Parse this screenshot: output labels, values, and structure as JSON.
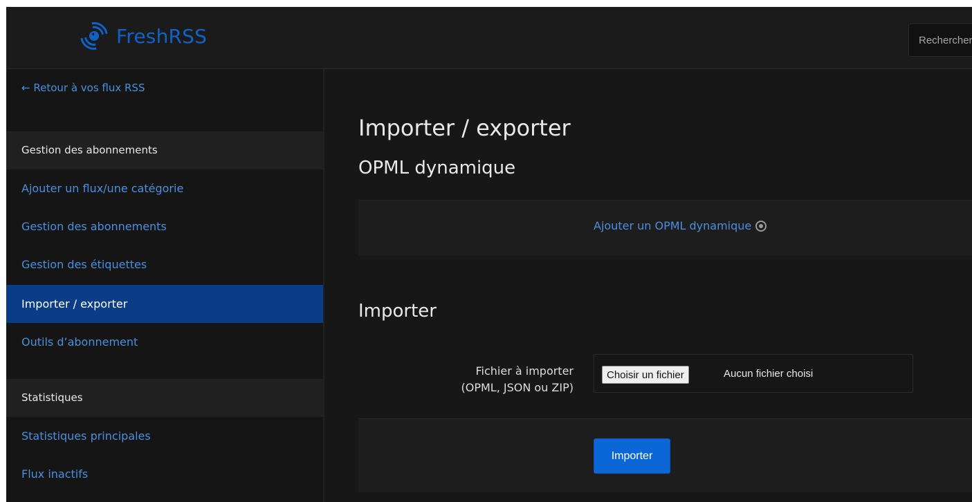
{
  "header": {
    "app_name": "FreshRSS",
    "logo_icon": "rss-signal-icon",
    "search_placeholder": "Rechercher"
  },
  "sidebar": {
    "back_link": "← Retour à vos flux RSS",
    "groups": [
      {
        "title": "Gestion des abonnements",
        "items": [
          {
            "label": "Ajouter un flux/une catégorie",
            "active": false
          },
          {
            "label": "Gestion des abonnements",
            "active": false
          },
          {
            "label": "Gestion des étiquettes",
            "active": false
          },
          {
            "label": "Importer / exporter",
            "active": true
          },
          {
            "label": "Outils d’abonnement",
            "active": false
          }
        ]
      },
      {
        "title": "Statistiques",
        "items": [
          {
            "label": "Statistiques principales",
            "active": false
          },
          {
            "label": "Flux inactifs",
            "active": false
          }
        ]
      }
    ]
  },
  "main": {
    "title": "Importer / exporter",
    "opml_section": {
      "title": "OPML dynamique",
      "add_link": "Ajouter un OPML dynamique",
      "help_icon": "help-circle-icon"
    },
    "import_section": {
      "title": "Importer",
      "file_label_line1": "Fichier à importer",
      "file_label_line2": "(OPML, JSON ou ZIP)",
      "choose_button": "Choisir un fichier",
      "no_file_text": "Aucun fichier choisi",
      "submit_label": "Importer"
    }
  },
  "colors": {
    "accent": "#0f63c8",
    "link": "#4a8fdf",
    "active_item_bg": "#0b3d86",
    "button": "#0b66d6",
    "background": "#171717"
  }
}
